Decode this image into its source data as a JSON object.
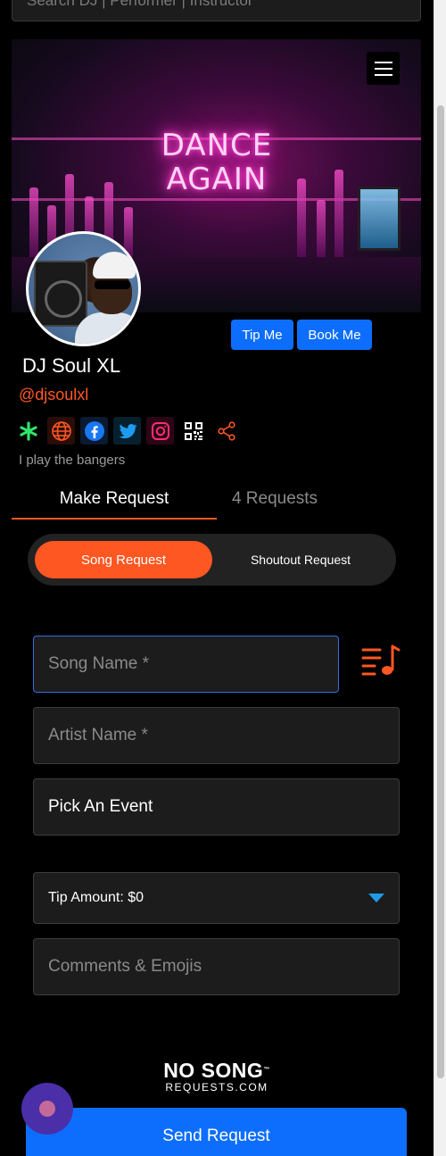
{
  "search": {
    "placeholder": "Search DJ | Performer | Instructor"
  },
  "banner": {
    "neon_text_line1": "DANCE",
    "neon_text_line2": "AGAIN"
  },
  "profile": {
    "name": "DJ Soul XL",
    "handle": "@djsoulxl",
    "bio": "I play the bangers",
    "tip_label": "Tip Me",
    "book_label": "Book Me",
    "socials": [
      "linktree-icon",
      "website-icon",
      "facebook-icon",
      "twitter-icon",
      "instagram-icon",
      "qr-code-icon",
      "share-icon"
    ]
  },
  "tabs": {
    "make_request": "Make Request",
    "requests_count": "4 Requests"
  },
  "request_type": {
    "song": "Song Request",
    "shoutout": "Shoutout Request"
  },
  "form": {
    "song_placeholder": "Song Name *",
    "artist_placeholder": "Artist Name *",
    "event_label": "Pick An Event",
    "tip_label": "Tip Amount: $0",
    "comments_placeholder": "Comments & Emojis"
  },
  "logo": {
    "top": "NO SONG",
    "tm": "™",
    "bottom": "REQUESTS.COM"
  },
  "send_label": "Send Request",
  "colors": {
    "accent": "#ff5722",
    "primary": "#0d6efd",
    "background": "#000000",
    "field": "#1c1c1c"
  }
}
